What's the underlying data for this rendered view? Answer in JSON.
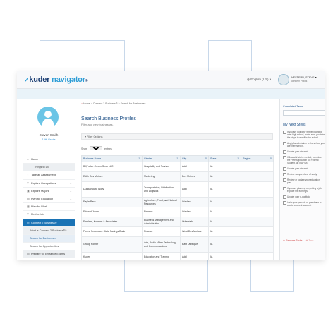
{
  "header": {
    "brand_kuder": "kuder",
    "brand_navigator": "navigator",
    "brand_mark": "®",
    "language": "English (US) ▾",
    "user_name": "WESTERN, STEVE ▾",
    "user_sub": "Northern Plains"
  },
  "profile": {
    "name": "Steven Smith",
    "grade": "12th Grade"
  },
  "sidebar": {
    "items": [
      {
        "label": "Home",
        "icon": "home-icon",
        "glyph": "⌂",
        "chev": ""
      },
      {
        "label": "Things to Do",
        "icon": "",
        "glyph": "",
        "chev": ""
      },
      {
        "label": "Take an Assessment",
        "icon": "assessment-icon",
        "glyph": "◔",
        "chev": ""
      },
      {
        "label": "Explore Occupations",
        "icon": "occupations-icon",
        "glyph": "⚲",
        "chev": "⌄"
      },
      {
        "label": "Explore Majors",
        "icon": "majors-icon",
        "glyph": "▣",
        "chev": "⌄"
      },
      {
        "label": "Plan for Education",
        "icon": "education-icon",
        "glyph": "▤",
        "chev": "⌄"
      },
      {
        "label": "Plan for Work",
        "icon": "work-icon",
        "glyph": "▦",
        "chev": "⌄"
      },
      {
        "label": "Find a Job",
        "icon": "job-icon",
        "glyph": "⚲",
        "chev": ""
      },
      {
        "label": "Connect 2 Business®",
        "icon": "connect-icon",
        "glyph": "◎",
        "chev": "⌃"
      },
      {
        "label": "What is Connect 2 Business®?",
        "icon": "",
        "glyph": "",
        "chev": ""
      },
      {
        "label": "Search for Businesses",
        "icon": "",
        "glyph": "",
        "chev": ""
      },
      {
        "label": "Search for Opportunities",
        "icon": "",
        "glyph": "",
        "chev": ""
      },
      {
        "label": "Prepare for Entrance Exams",
        "icon": "exams-icon",
        "glyph": "▤",
        "chev": ""
      }
    ]
  },
  "breadcrumb": {
    "home": "Home",
    "sep1": ">",
    "connect": "Connect 2 Business®",
    "sep2": ">",
    "current": "Search for Businesses"
  },
  "main": {
    "title": "Search Business Profiles",
    "subtitle": "Filter and view businesses.",
    "filter_label": "Filter Options",
    "show_prefix": "Show",
    "show_value": "10",
    "show_suffix": "entries"
  },
  "table": {
    "headers": [
      "Business Name",
      "Cluster",
      "City",
      "State",
      "Region"
    ],
    "rows": [
      {
        "name": "Billy's Ice Cream Shop LLC",
        "cluster": "Hospitality and Tourism",
        "city": "Adel",
        "state": "IA",
        "region": "",
        "size": "mid"
      },
      {
        "name": "Edith Des Moines",
        "cluster": "Marketing",
        "city": "Des Moines",
        "state": "IA",
        "region": "",
        "size": "mid"
      },
      {
        "name": "Dungan Auto Body",
        "cluster": "Transportation, Distribution, and Logistics",
        "city": "Adel",
        "state": "IA",
        "region": "",
        "size": "tall"
      },
      {
        "name": "Eagle Pass",
        "cluster": "Agriculture, Food, and Natural Resources",
        "city": "Waukee",
        "state": "IA",
        "region": "",
        "size": "mid"
      },
      {
        "name": "Edward Jones",
        "cluster": "Finance",
        "city": "Waukee",
        "state": "IA",
        "region": "",
        "size": "mid"
      },
      {
        "name": "Emblem, Koerber & Associates",
        "cluster": "Business Management and Administration",
        "city": "Urbandale",
        "state": "IA",
        "region": "",
        "size": "mid"
      },
      {
        "name": "Forest Secondary State Savings Bank",
        "cluster": "Finance",
        "city": "West Des Moines",
        "state": "IA",
        "region": "",
        "size": "mid"
      },
      {
        "name": "Group Homer",
        "cluster": "Arts, Audio-Video Technology, and Communications",
        "city": "East Dubuque",
        "state": "IA",
        "region": "",
        "size": "tall"
      },
      {
        "name": "Kuder",
        "cluster": "Education and Training",
        "city": "Adel",
        "state": "IA",
        "region": "",
        "size": "mid"
      }
    ]
  },
  "right_panel": {
    "completed_label": "Completed Tasks",
    "next_steps_title": "My Next Steps",
    "steps": [
      "If you are going for further learning after high school, make sure you take the steps to enroll in the school.",
      "Apply for admission to the school you are interested in.",
      "Update your résumé.",
      "If financial aid is needed, complete the Free Application for Federal Student Aid (FAFSA).",
      "Update your résumé.",
      "Review sample plans of study.",
      "Review or update your education plan.",
      "If you are planning on getting a job, explore the earnings.",
      "Update your e-portfolio.",
      "Invite your parents or guardians to create a parent account."
    ],
    "remove_link": "Remove Tasks",
    "ghost_link": "Tour"
  }
}
